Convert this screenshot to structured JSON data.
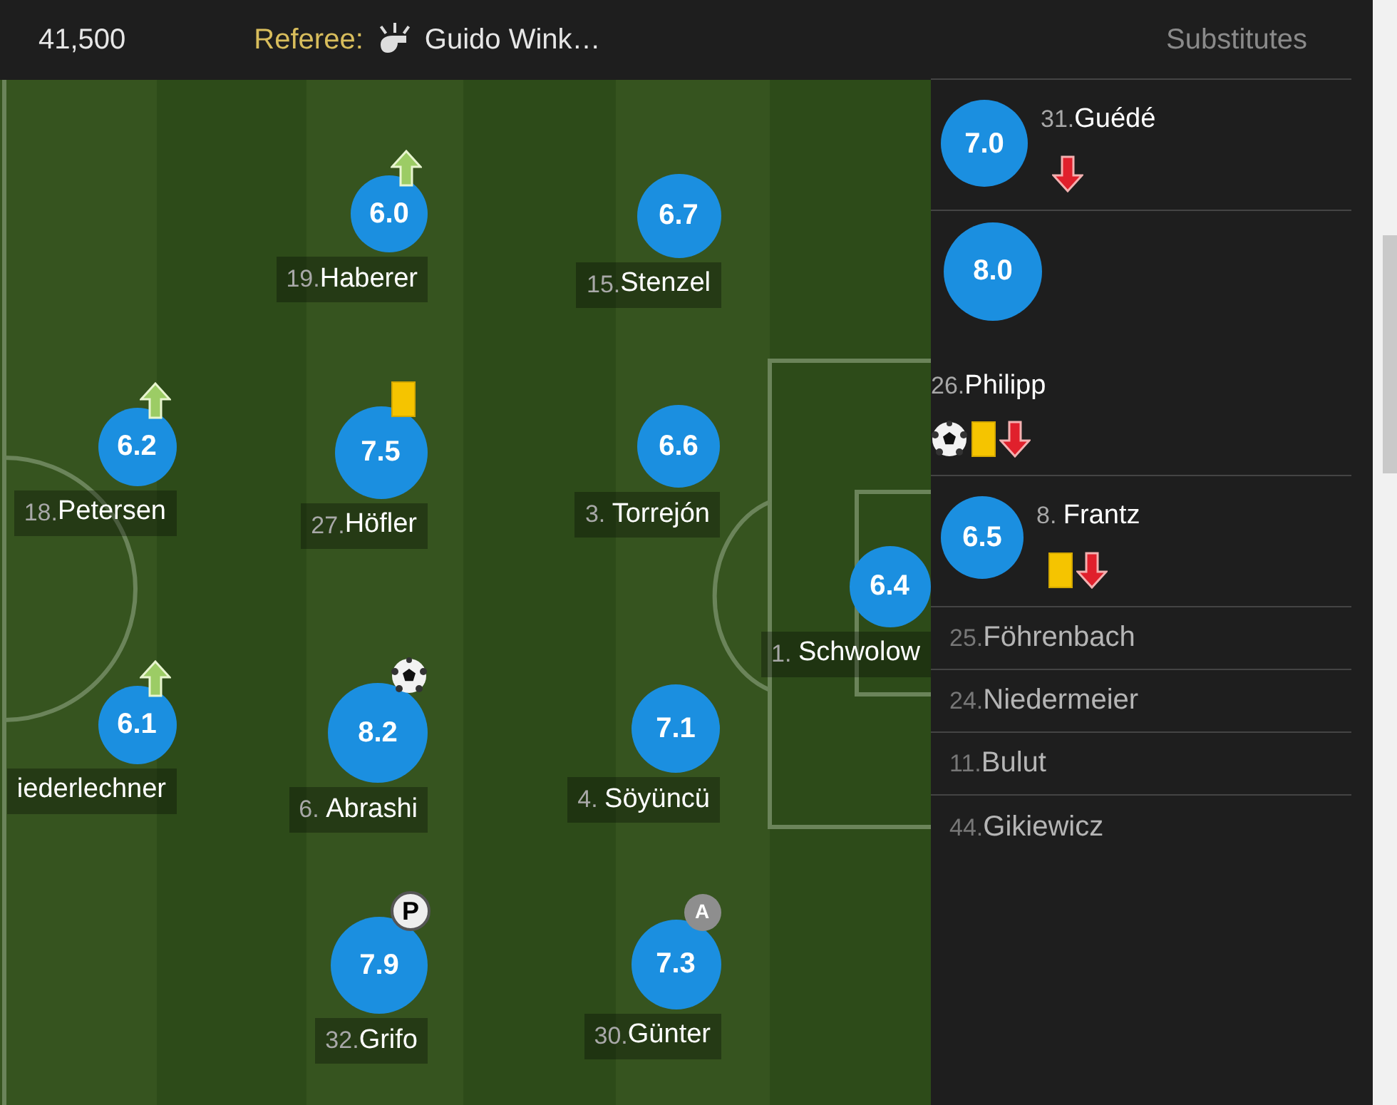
{
  "header": {
    "attendance": "41,500",
    "referee_label": "Referee:",
    "referee_name": "Guido Wink…"
  },
  "pitch": {
    "players": [
      {
        "number": "19.",
        "name": "Haberer",
        "rating": "6.0",
        "events": [
          {
            "kind": "sub_on"
          }
        ]
      },
      {
        "number": "15.",
        "name": "Stenzel",
        "rating": "6.7"
      },
      {
        "number": "18.",
        "name": "Petersen",
        "rating": "6.2",
        "events": [
          {
            "kind": "sub_on"
          }
        ]
      },
      {
        "number": "27.",
        "name": "Höfler",
        "rating": "7.5",
        "events": [
          {
            "kind": "yellow_card"
          }
        ]
      },
      {
        "number": "3. ",
        "name": "Torrejón",
        "rating": "6.6"
      },
      {
        "number": "1. ",
        "name": "Schwolow",
        "rating": "6.4"
      },
      {
        "name": "iederlechner",
        "rating": "6.1",
        "events": [
          {
            "kind": "sub_on"
          }
        ]
      },
      {
        "number": "6. ",
        "name": "Abrashi",
        "rating": "8.2",
        "events": [
          {
            "kind": "goal"
          }
        ]
      },
      {
        "number": "4. ",
        "name": "Söyüncü",
        "rating": "7.1"
      },
      {
        "number": "32.",
        "name": "Grifo",
        "rating": "7.9",
        "events": [
          {
            "kind": "penalty_goal",
            "label": "P"
          }
        ]
      },
      {
        "number": "30.",
        "name": "Günter",
        "rating": "7.3",
        "events": [
          {
            "kind": "assist",
            "label": "A"
          }
        ]
      }
    ]
  },
  "substitutes": {
    "title": "Substitutes",
    "players": [
      {
        "number": "31.",
        "name": "Guédé",
        "rating": "7.0",
        "events": [
          {
            "kind": "sub_off"
          }
        ]
      },
      {
        "number": "26.",
        "name": "Philipp",
        "rating": "8.0",
        "events": [
          {
            "kind": "goal"
          },
          {
            "kind": "yellow_card"
          },
          {
            "kind": "sub_off"
          }
        ]
      },
      {
        "number": "8. ",
        "name": "Frantz",
        "rating": "6.5",
        "events": [
          {
            "kind": "yellow_card"
          },
          {
            "kind": "sub_off"
          }
        ]
      },
      {
        "number": "25.",
        "name": "Föhrenbach"
      },
      {
        "number": "24.",
        "name": "Niedermeier"
      },
      {
        "number": "11.",
        "name": "Bulut"
      },
      {
        "number": "44.",
        "name": "Gikiewicz"
      }
    ]
  }
}
